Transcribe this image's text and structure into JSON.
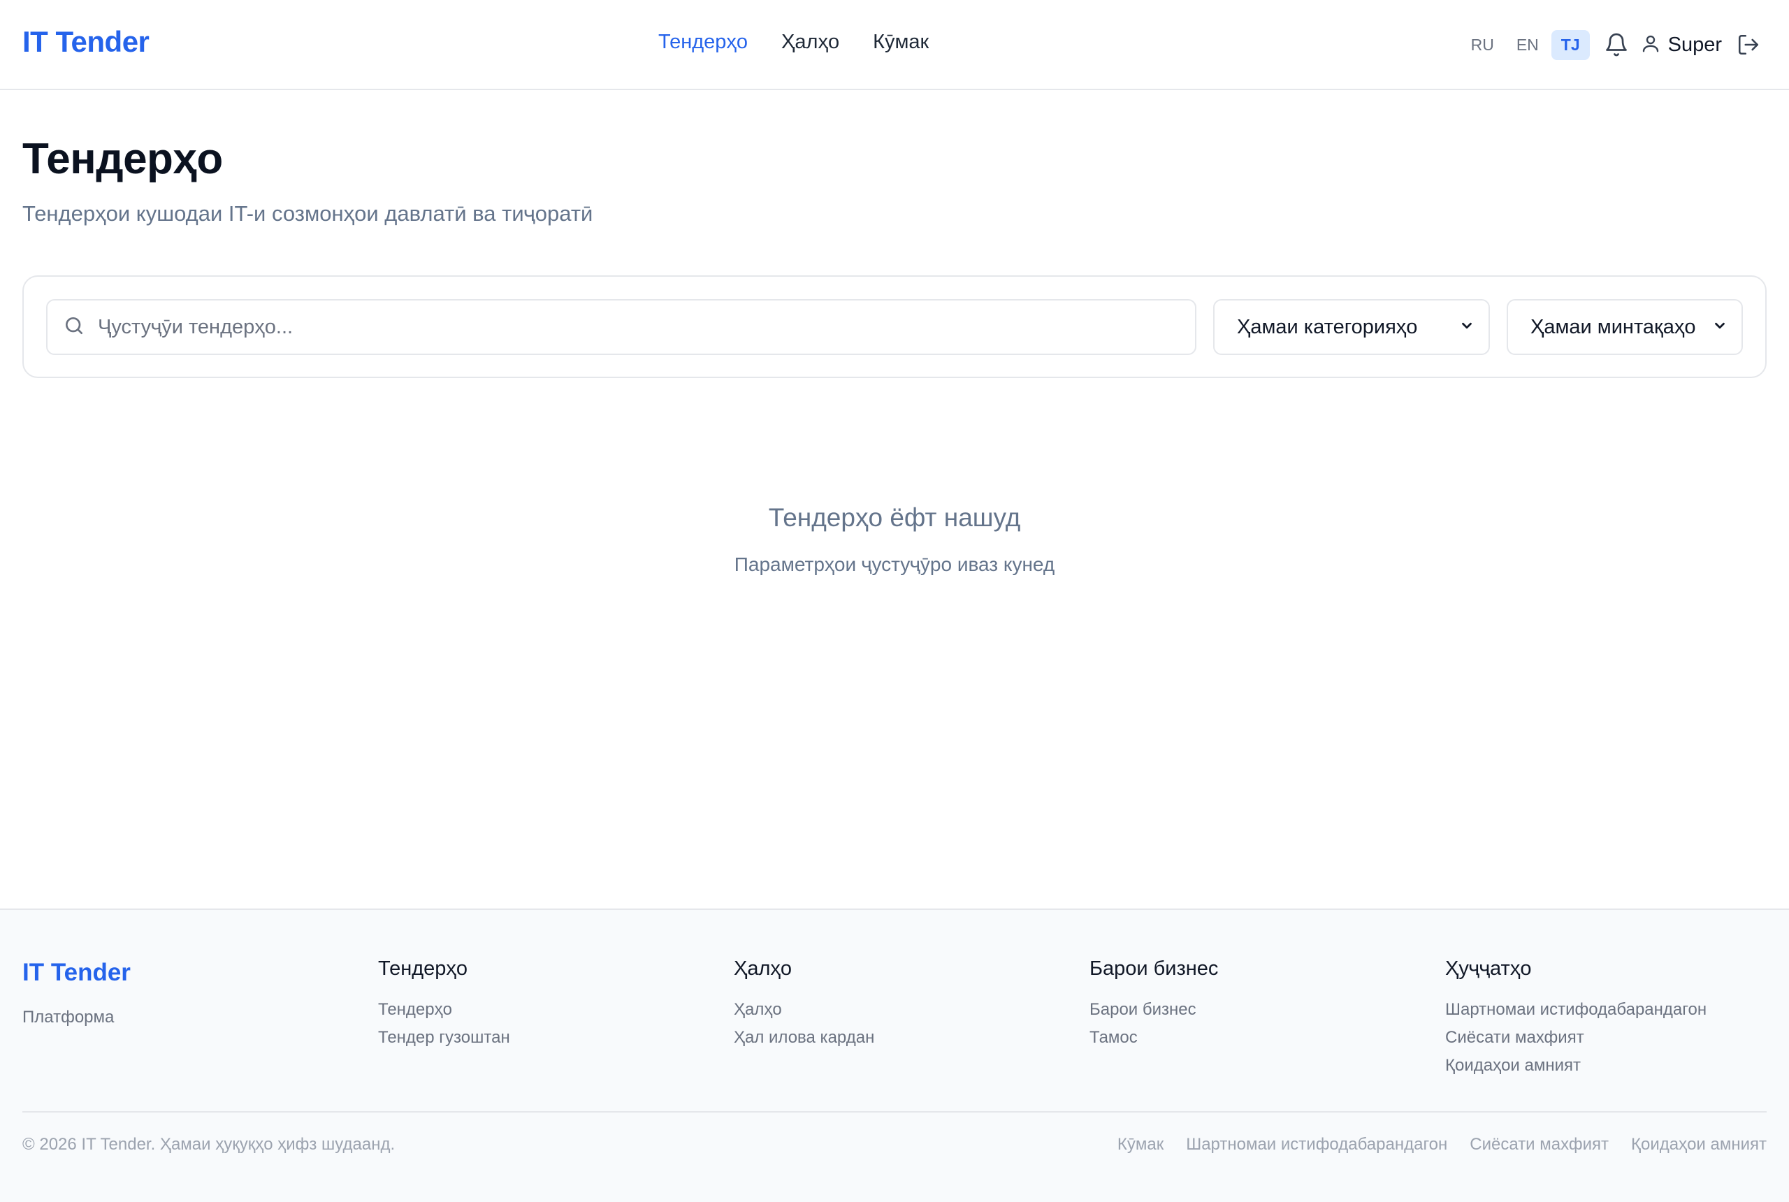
{
  "header": {
    "logo": "IT Tender",
    "nav": [
      {
        "label": "Тендерҳо",
        "active": true
      },
      {
        "label": "Ҳалҳо",
        "active": false
      },
      {
        "label": "Кӯмак",
        "active": false
      }
    ],
    "languages": [
      {
        "label": "RU",
        "active": false
      },
      {
        "label": "EN",
        "active": false
      },
      {
        "label": "TJ",
        "active": true
      }
    ],
    "user_name": "Super",
    "icons": [
      "bell-icon",
      "user-icon",
      "logout-icon"
    ]
  },
  "main": {
    "title": "Тендерҳо",
    "subtitle": "Тендерҳои кушодаи IT-и созмонҳои давлатӣ ва тиҷоратӣ",
    "search": {
      "placeholder": "Ҷустуҷӯи тендерҳо...",
      "value": ""
    },
    "category_select": {
      "selected": "Ҳамаи категорияҳо"
    },
    "region_select": {
      "selected": "Ҳамаи минтақаҳо"
    },
    "empty_state": {
      "title": "Тендерҳо ёфт нашуд",
      "subtitle": "Параметрҳои ҷустуҷӯро иваз кунед"
    }
  },
  "footer": {
    "logo": "IT Tender",
    "tagline": "Платформа",
    "columns": [
      {
        "title": "Тендерҳо",
        "links": [
          "Тендерҳо",
          "Тендер гузоштан"
        ]
      },
      {
        "title": "Ҳалҳо",
        "links": [
          "Ҳалҳо",
          "Ҳал илова кардан"
        ]
      },
      {
        "title": "Барои бизнес",
        "links": [
          "Барои бизнес",
          "Тамос"
        ]
      },
      {
        "title": "Ҳуҷҷатҳо",
        "links": [
          "Шартномаи истифодабарандагон",
          "Сиёсати махфият",
          "Қоидаҳои амният"
        ]
      }
    ],
    "copyright": "© 2026 IT Tender. Ҳамаи ҳуқуқҳо ҳифз шудаанд.",
    "bottom_links": [
      "Кӯмак",
      "Шартномаи истифодабарандагон",
      "Сиёсати махфият",
      "Қоидаҳои амният"
    ]
  },
  "colors": {
    "accent": "#2563eb",
    "muted": "#64748b",
    "border": "#e5e7eb"
  }
}
